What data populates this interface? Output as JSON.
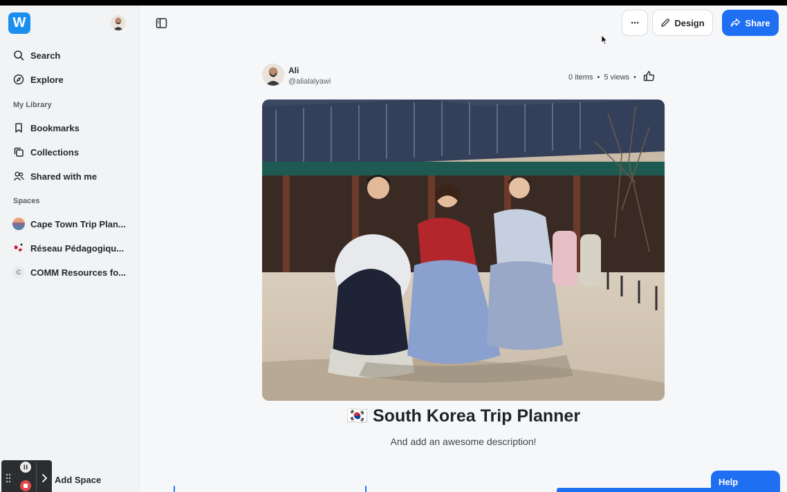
{
  "sidebar": {
    "logo_letter": "W",
    "nav": [
      {
        "label": "Search",
        "icon": "search-icon"
      },
      {
        "label": "Explore",
        "icon": "compass-icon"
      }
    ],
    "my_library_label": "My Library",
    "library": [
      {
        "label": "Bookmarks",
        "icon": "bookmark-icon"
      },
      {
        "label": "Collections",
        "icon": "collections-icon"
      },
      {
        "label": "Shared with me",
        "icon": "users-icon"
      }
    ],
    "spaces_label": "Spaces",
    "spaces": [
      {
        "label": "Cape Town Trip Plan..."
      },
      {
        "label": "Réseau Pédagogiqu..."
      },
      {
        "label": "COMM Resources fo...",
        "initial": "C"
      }
    ],
    "add_space_label": "Add Space"
  },
  "header": {
    "more_label": "···",
    "design_label": "Design",
    "share_label": "Share"
  },
  "post": {
    "author_name": "Ali",
    "author_handle": "@alialalyawi",
    "items": "0 items",
    "views": "5 views",
    "title": "🇰🇷 South Korea Trip Planner",
    "description": "And add an awesome description!"
  },
  "help_label": "Help",
  "colors": {
    "accent": "#1f6ff2",
    "logo": "#1b8ff0"
  }
}
